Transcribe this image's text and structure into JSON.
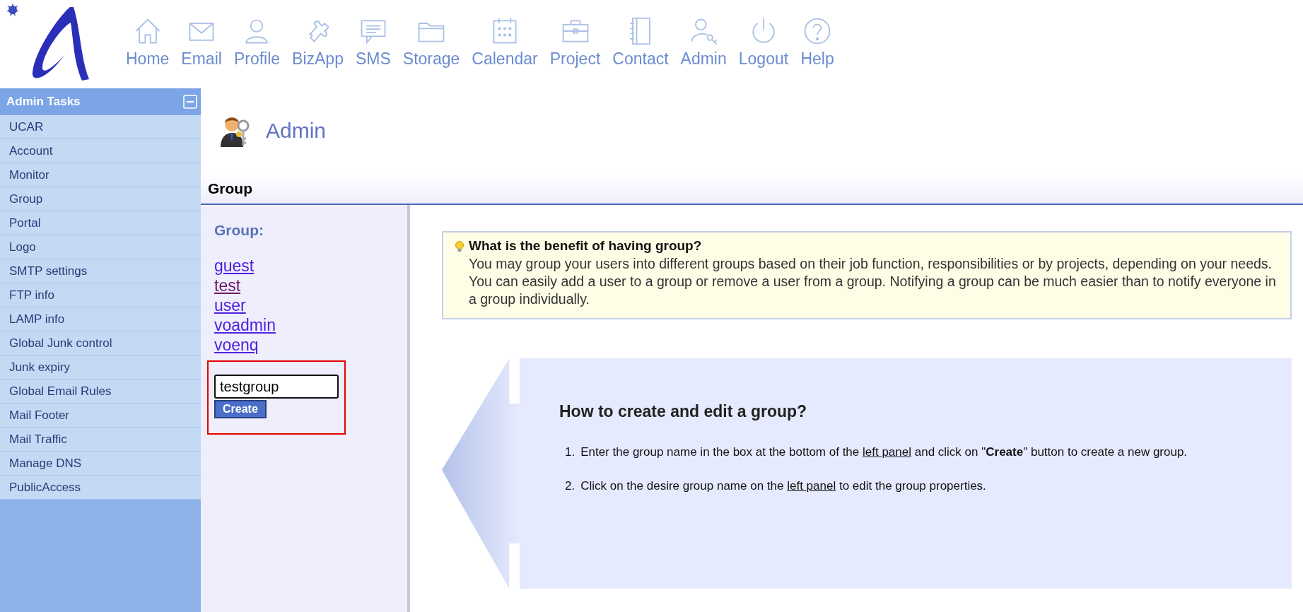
{
  "nav": [
    {
      "label": "Home"
    },
    {
      "label": "Email"
    },
    {
      "label": "Profile"
    },
    {
      "label": "BizApp"
    },
    {
      "label": "SMS"
    },
    {
      "label": "Storage"
    },
    {
      "label": "Calendar"
    },
    {
      "label": "Project"
    },
    {
      "label": "Contact"
    },
    {
      "label": "Admin"
    },
    {
      "label": "Logout"
    },
    {
      "label": "Help"
    }
  ],
  "sidebar": {
    "title": "Admin Tasks",
    "items": [
      {
        "label": "UCAR"
      },
      {
        "label": "Account"
      },
      {
        "label": "Monitor"
      },
      {
        "label": "Group"
      },
      {
        "label": "Portal"
      },
      {
        "label": "Logo"
      },
      {
        "label": "SMTP settings"
      },
      {
        "label": "FTP info"
      },
      {
        "label": "LAMP info"
      },
      {
        "label": "Global Junk control"
      },
      {
        "label": "Junk expiry"
      },
      {
        "label": "Global Email Rules"
      },
      {
        "label": "Mail Footer"
      },
      {
        "label": "Mail Traffic"
      },
      {
        "label": "Manage DNS"
      },
      {
        "label": "PublicAccess"
      }
    ]
  },
  "page_title": "Admin",
  "section_title": "Group",
  "group_panel": {
    "heading": "Group:",
    "groups": [
      {
        "name": "guest",
        "visited": false
      },
      {
        "name": "test",
        "visited": true
      },
      {
        "name": "user",
        "visited": false
      },
      {
        "name": "voadmin",
        "visited": false
      },
      {
        "name": "voenq",
        "visited": false
      }
    ],
    "input_value": "testgroup",
    "create_button": "Create"
  },
  "tip": {
    "title": "What is the benefit of having group?",
    "text": "You may group your users into different groups based on their job function, responsibilities or by projects, depending on your needs. You can easily add a user to a group or remove a user from a group. Notifying a group can be much easier than to notify everyone in a group individually."
  },
  "howto": {
    "title": "How to create and edit a group?",
    "steps": [
      {
        "number": "1.",
        "parts": [
          {
            "kind": "text",
            "text": "Enter the group name in the box at the bottom of the "
          },
          {
            "kind": "link",
            "text": "left panel"
          },
          {
            "kind": "text",
            "text": " and click on \"**Create**\" button to create a new group."
          }
        ]
      },
      {
        "number": "2.",
        "parts": [
          {
            "kind": "text",
            "text": "Click on the desire group name on the "
          },
          {
            "kind": "link",
            "text": "left panel"
          },
          {
            "kind": "text",
            "text": " to edit the group properties."
          }
        ]
      }
    ]
  }
}
